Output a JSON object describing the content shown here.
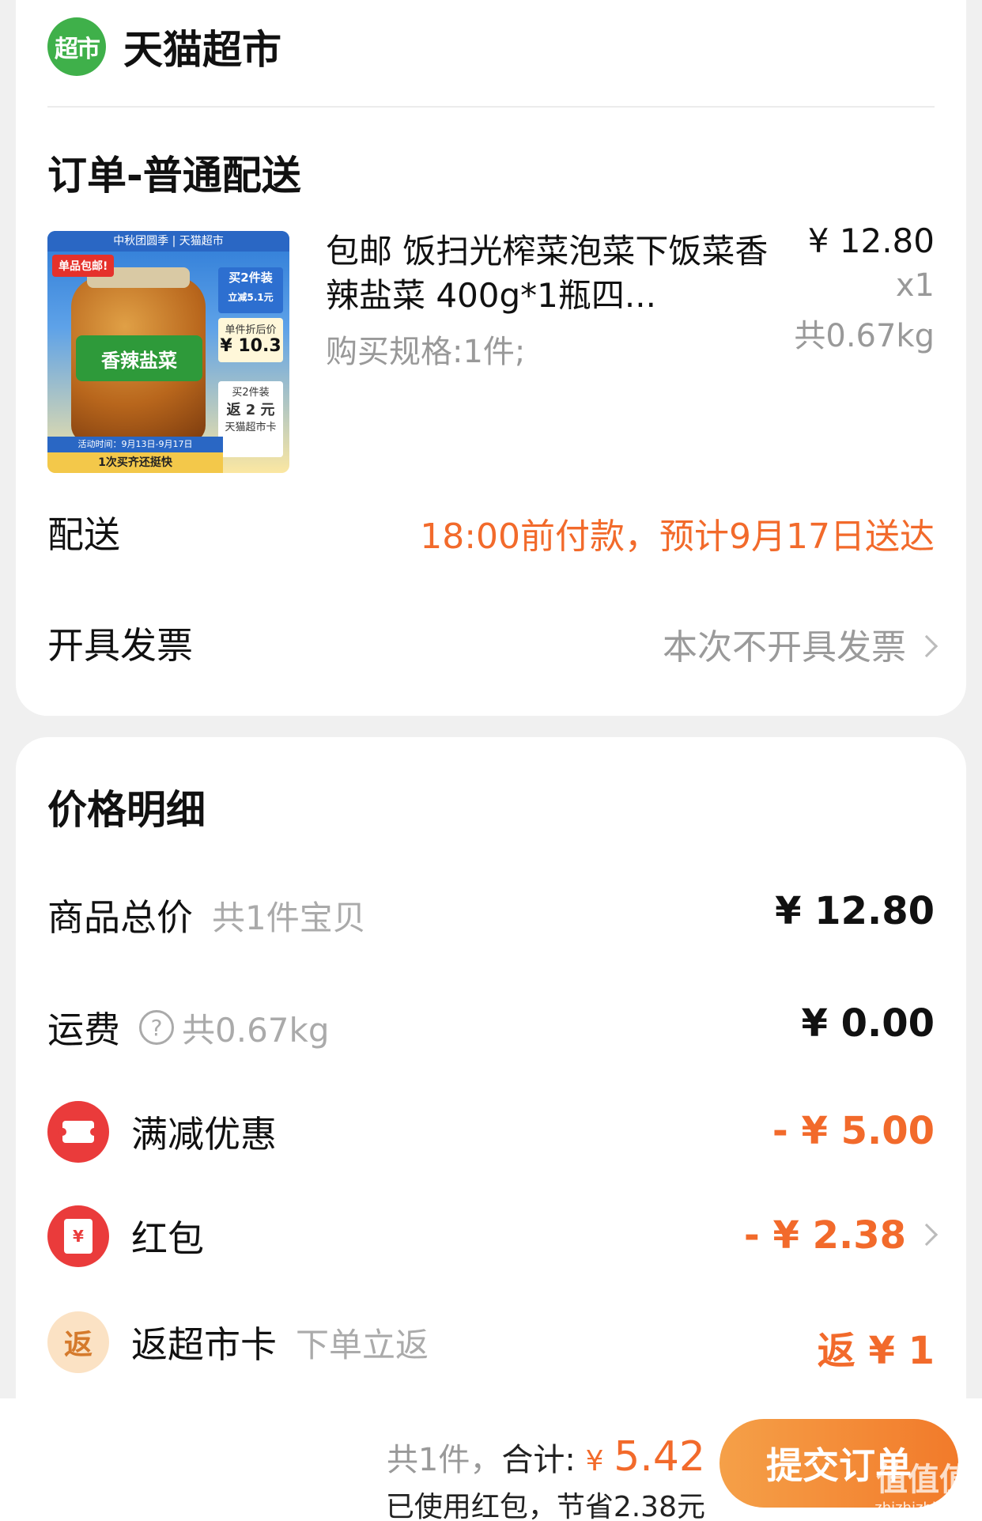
{
  "store": {
    "logo_text": "超市",
    "name": "天猫超市"
  },
  "order": {
    "section_title": "订单-普通配送",
    "product": {
      "image_texts": {
        "top_banner": "中秋团圆季 | 天猫超市",
        "tag": "单品包邮!",
        "jar_label": "香辣盐菜",
        "promo1_line1": "买2件装",
        "promo1_line2": "立减5.1元",
        "promo2_line1": "单件折后价",
        "promo2_price": "¥ 10.3",
        "promo3_line1": "买2件装",
        "promo3_line2": "返 2 元",
        "promo3_line3": "天猫超市卡",
        "date": "活动时间：9月13日-9月17日",
        "bottom": "1次买齐还挺快"
      },
      "title": "包邮 饭扫光榨菜泡菜下饭菜香辣盐菜 400g*1瓶四...",
      "spec": "购买规格:1件;",
      "price": "¥ 12.80",
      "qty": "x1",
      "weight": "共0.67kg"
    },
    "delivery": {
      "label": "配送",
      "value": "18:00前付款，预计9月17日送达"
    },
    "invoice": {
      "label": "开具发票",
      "value": "本次不开具发票"
    }
  },
  "price_detail": {
    "section_title": "价格明细",
    "goods_total": {
      "label": "商品总价",
      "sub": "共1件宝贝",
      "value": "¥ 12.80"
    },
    "shipping": {
      "label": "运费",
      "help": "?",
      "sub": "共0.67kg",
      "value": "¥ 0.00"
    },
    "discount": {
      "label": "满减优惠",
      "value": "- ¥ 5.00"
    },
    "red_packet": {
      "label": "红包",
      "icon_glyph": "¥",
      "value": "- ¥ 2.38"
    },
    "rebate": {
      "label": "返超市卡",
      "icon_glyph": "返",
      "sub": "下单立返",
      "value": "返 ¥ 1"
    }
  },
  "footer": {
    "count": "共1件，",
    "total_label": "合计:",
    "currency": "¥",
    "total_amount": "5.42",
    "saved": "已使用红包，节省2.38元",
    "submit": "提交订单",
    "watermark_big": "值值值",
    "watermark_small": "zhizhizhi.com"
  },
  "colors": {
    "accent": "#f26a2b",
    "brand_green": "#3fb04a",
    "red_icon": "#ea3b3b"
  }
}
